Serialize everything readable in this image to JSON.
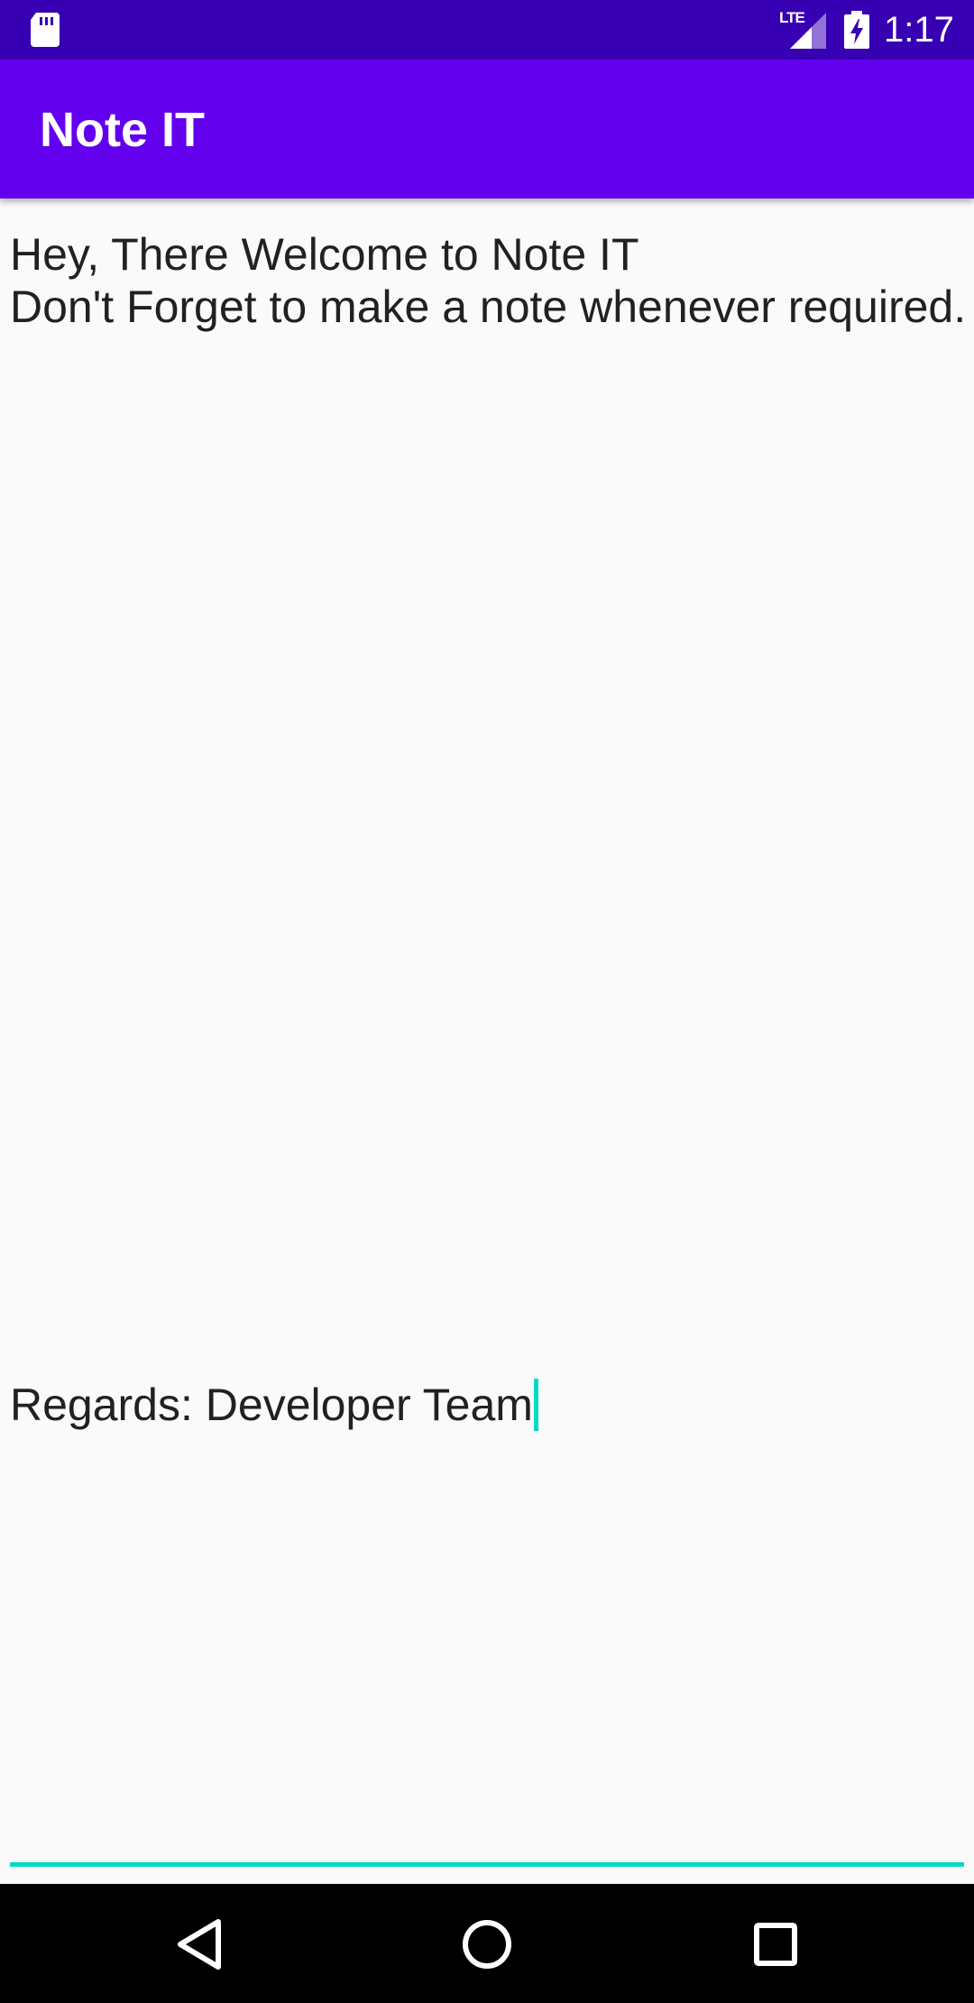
{
  "status_bar": {
    "time": "1:17",
    "network_label": "LTE",
    "icons": [
      "sd-card-icon",
      "lte-signal-icon",
      "battery-charging-icon"
    ],
    "background_color": "#3700b3"
  },
  "app_bar": {
    "title": "Note IT",
    "background_color": "#6200ee"
  },
  "note": {
    "lines": [
      "Hey, There Welcome to Note IT",
      "Don't Forget to make a note whenever required.",
      "Regards: Developer Team"
    ],
    "accent_color": "#03dac5"
  },
  "nav_bar": {
    "buttons": [
      "back-icon",
      "home-icon",
      "recents-icon"
    ]
  }
}
